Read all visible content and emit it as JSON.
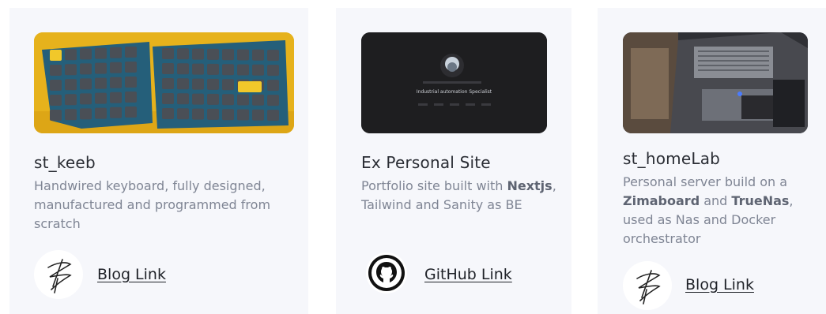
{
  "cards": [
    {
      "title": "st_keeb",
      "description": "Handwired keyboard, fully designed, manufactured and programmed from scratch",
      "link_label": "Blog Link",
      "link_icon": "signature-icon",
      "image": "keyboard-photo"
    },
    {
      "title": "Ex Personal Site",
      "description_parts": [
        "Portfolio site built with ",
        "Nextjs",
        ", Tailwind and Sanity as BE"
      ],
      "link_label": "GitHub Link",
      "link_icon": "github-icon",
      "image": "website-screenshot",
      "image_caption": "Industrial automation Specialist"
    },
    {
      "title": "st_homeLab",
      "description_parts": [
        "Personal server build on a ",
        "Zimaboard",
        " and ",
        "TrueNas",
        ", used as Nas and Docker orchestrator"
      ],
      "link_label": "Blog Link",
      "link_icon": "signature-icon",
      "image": "homelab-photo"
    }
  ],
  "colors": {
    "card_bg": "#f6f7fb",
    "title": "#2a2d34",
    "text": "#7f8594",
    "link": "#1f2228"
  }
}
